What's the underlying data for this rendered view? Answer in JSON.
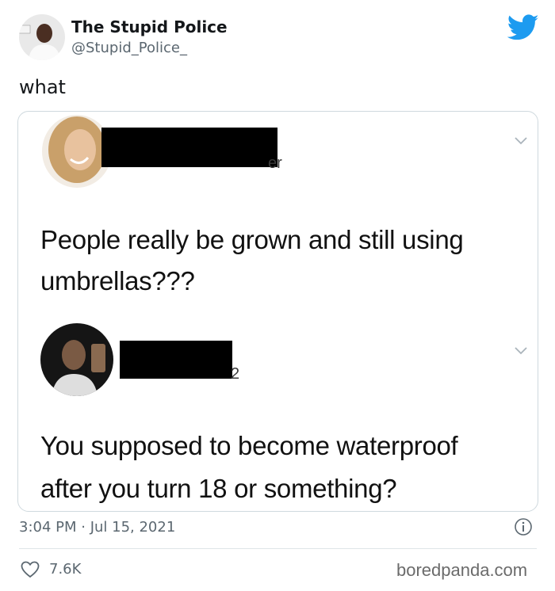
{
  "author": {
    "display_name": "The Stupid Police",
    "handle": "@Stupid_Police_"
  },
  "tweet_text": "what",
  "embedded": {
    "first": {
      "handle_fragment": "er",
      "text_line1": "People really be grown and still using",
      "text_line2": "umbrellas???"
    },
    "second": {
      "handle_fragment": "2",
      "text_line1": "You supposed to become waterproof",
      "text_line2": "after you turn 18 or something?"
    }
  },
  "meta": {
    "timestamp": "3:04 PM · Jul 15, 2021",
    "likes": "7.6K"
  },
  "watermark": "boredpanda.com",
  "colors": {
    "twitter_blue": "#1d9bf0",
    "muted": "#5b6770"
  }
}
